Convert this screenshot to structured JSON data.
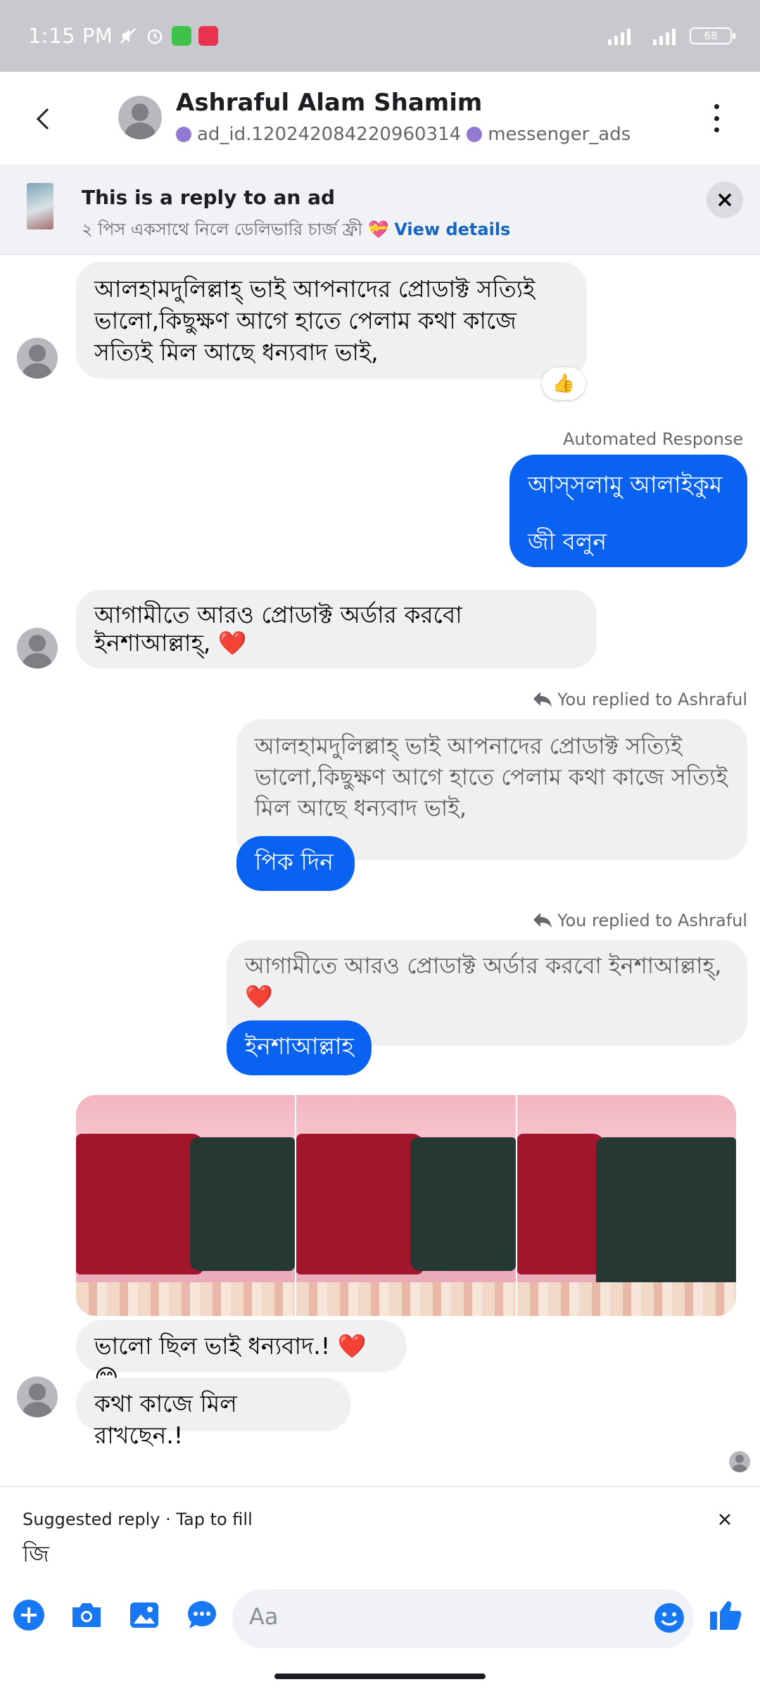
{
  "status_bar": {
    "time": "1:15 PM",
    "battery": "68"
  },
  "header": {
    "contact_name": "Ashraful Alam Shamim",
    "ad_id": "ad_id.120242084220960314",
    "source": "messenger_ads"
  },
  "ad_banner": {
    "title": "This is a reply to an ad",
    "description": "২ পিস একসাথে নিলে ডেলিভারি চার্জ ফ্রী 💝",
    "link": "View details"
  },
  "messages": {
    "m1": "আলহামদুলিল্লাহ্ ভাই আপনাদের প্রোডাক্ট সত্যিই ভালো,কিছুক্ষণ আগে হাতে পেলাম কথা কাজে সত্যিই মিল আছে ধন্যবাদ ভাই,",
    "m1_reaction": "👍",
    "auto_label": "Automated Response",
    "m2_line1": "আস্সলামু আলাইকুম",
    "m2_line2": "জী বলুন",
    "m3": "আগামীতে আরও প্রোডাক্ট অর্ডার করবো ইনশাআল্লাহ্, ❤️",
    "reply_label_1": "You replied to Ashraful",
    "quote_1": "আলহামদুলিল্লাহ্ ভাই আপনাদের প্রোডাক্ট সত্যিই ভালো,কিছুক্ষণ আগে হাতে পেলাম কথা কাজে সত্যিই মিল আছে ধন্যবাদ ভাই,",
    "reply_1": "পিক দিন",
    "reply_label_2": "You replied to Ashraful",
    "quote_2": "আগামীতে আরও প্রোডাক্ট অর্ডার করবো ইনশাআল্লাহ্, ❤️",
    "reply_2": "ইনশাআল্লাহ",
    "m4": "ভালো ছিল ভাই ধন্যবাদ.!  ❤️😊",
    "m5": "কথা কাজে মিল রাখছেন.!"
  },
  "suggested_reply": {
    "label": "Suggested reply · Tap to fill",
    "text": "জি"
  },
  "composer": {
    "placeholder": "Aa"
  },
  "colors": {
    "outgoing": "#0a63f0",
    "incoming": "#f0f0f0",
    "accent": "#1877f2"
  },
  "icons": [
    "back-arrow-icon",
    "more-vertical-icon",
    "close-icon",
    "reply-arrow-icon",
    "plus-icon",
    "camera-icon",
    "gallery-icon",
    "chat-extension-icon",
    "emoji-icon",
    "like-icon"
  ]
}
